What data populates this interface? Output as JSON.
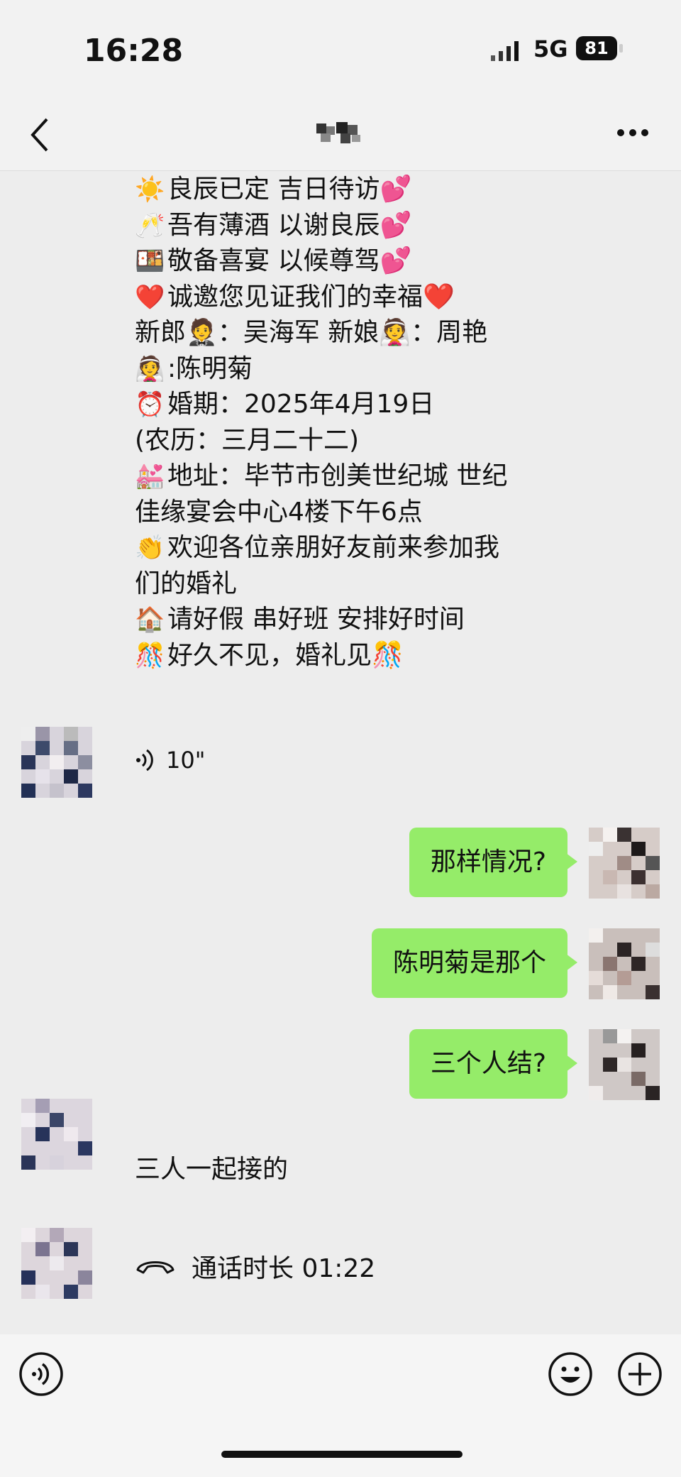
{
  "status": {
    "time": "16:28",
    "network": "5G",
    "battery": "81"
  },
  "nav": {
    "back_icon": "chevron-left-icon",
    "more_icon": "ellipsis-icon"
  },
  "invite": {
    "lines": [
      {
        "emoji": "☀️",
        "text": "良辰已定 吉日待访",
        "tail": "💕"
      },
      {
        "emoji": "🥂",
        "text": "吾有薄酒 以谢良辰",
        "tail": "💕"
      },
      {
        "emoji": "🍱",
        "text": "敬备喜宴 以候尊驾",
        "tail": "💕"
      },
      {
        "emoji": "❤️",
        "text": "诚邀您见证我们的幸福",
        "tail": "❤️"
      },
      {
        "emoji": "",
        "text": "新郎🤵：吴海军  新娘👰：周艳",
        "tail": ""
      },
      {
        "emoji": "👰",
        "text": " :陈明菊",
        "tail": ""
      },
      {
        "emoji": "⏰",
        "text": "婚期：2025年4月19日",
        "tail": ""
      },
      {
        "emoji": "",
        "text": "(农历：三月二十二)",
        "tail": ""
      },
      {
        "emoji": "💒",
        "text": "地址：毕节市创美世纪城  世纪",
        "tail": ""
      },
      {
        "emoji": "",
        "text": "佳缘宴会中心4楼下午6点",
        "tail": ""
      },
      {
        "emoji": "👏",
        "text": "欢迎各位亲朋好友前来参加我",
        "tail": ""
      },
      {
        "emoji": "",
        "text": "们的婚礼",
        "tail": ""
      },
      {
        "emoji": "🏠",
        "text": "请好假 串好班 安排好时间",
        "tail": ""
      },
      {
        "emoji": "🎊",
        "text": "好久不见，婚礼见",
        "tail": "🎊"
      }
    ]
  },
  "messages": {
    "voice_duration": "10\"",
    "sent1": "那样情况?",
    "sent2": "陈明菊是那个",
    "sent3": "三个人结?",
    "recv1": "三人一起接的",
    "call": "通话时长 01:22"
  },
  "input": {
    "voice_icon": "voice-toggle-icon",
    "emoji_icon": "emoji-icon",
    "plus_icon": "plus-icon"
  }
}
